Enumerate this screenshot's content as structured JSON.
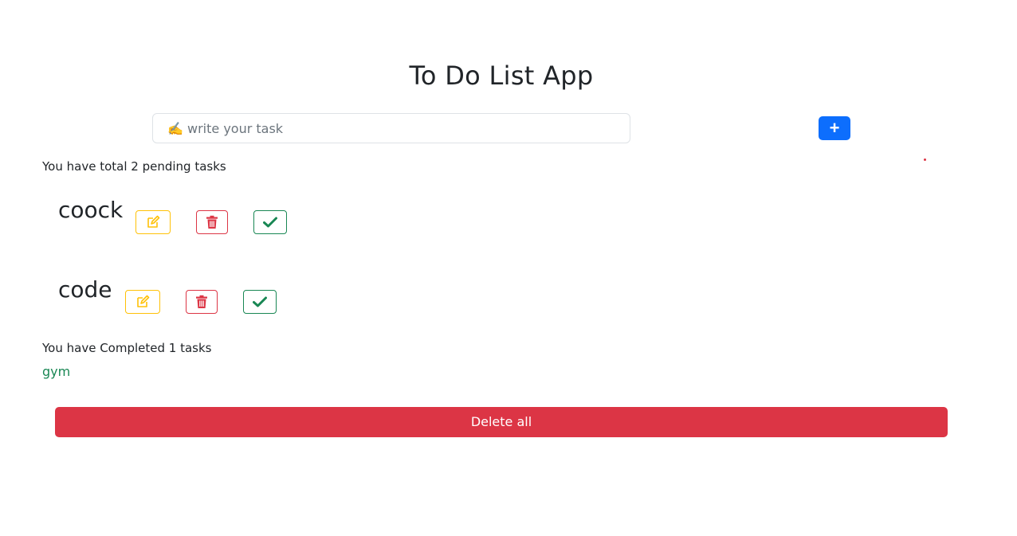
{
  "app": {
    "title": "To Do List App"
  },
  "input": {
    "placeholder": "✍️ write your task",
    "value": ""
  },
  "add_button": {
    "icon": "plus-icon",
    "label": "+"
  },
  "pending": {
    "summary": "You have total 2 pending tasks",
    "tasks": [
      {
        "name": "coock"
      },
      {
        "name": "code"
      }
    ]
  },
  "completed": {
    "summary": "You have Completed 1 tasks",
    "tasks": [
      {
        "name": "gym"
      }
    ]
  },
  "delete_all": {
    "label": "Delete all"
  },
  "colors": {
    "primary": "#0d6efd",
    "danger": "#dc3545",
    "warning": "#ffc107",
    "success": "#198754"
  }
}
